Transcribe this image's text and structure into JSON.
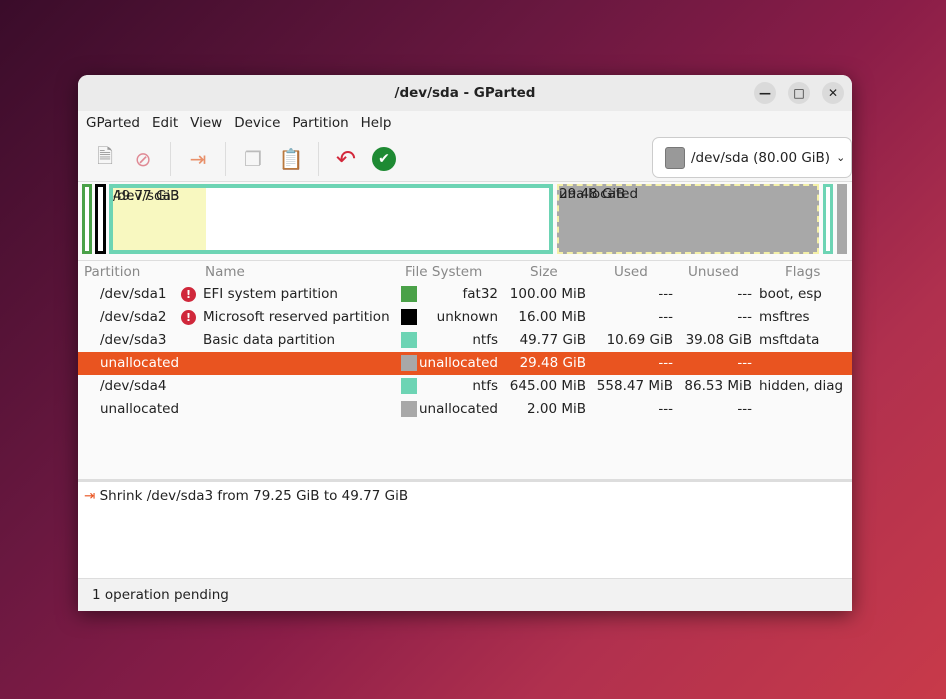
{
  "window": {
    "title": "/dev/sda - GParted"
  },
  "menu": [
    "GParted",
    "Edit",
    "View",
    "Device",
    "Partition",
    "Help"
  ],
  "device": {
    "label": "/dev/sda (80.00 GiB)"
  },
  "map": {
    "sda3": {
      "name": "/dev/sda3",
      "size": "49.77 GiB",
      "used_fraction": 0.21
    },
    "unalloc": {
      "name": "unallocated",
      "size": "29.48 GiB"
    }
  },
  "columns": [
    "Partition",
    "Name",
    "File System",
    "Size",
    "Used",
    "Unused",
    "Flags"
  ],
  "rows": [
    {
      "partition": "/dev/sda1",
      "name": "EFI system partition",
      "warn": true,
      "color": "#4aa148",
      "fs": "fat32",
      "size": "100.00 MiB",
      "used": "---",
      "unused": "---",
      "flags": "boot, esp"
    },
    {
      "partition": "/dev/sda2",
      "name": "Microsoft reserved partition",
      "warn": true,
      "color": "#000000",
      "fs": "unknown",
      "size": "16.00 MiB",
      "used": "---",
      "unused": "---",
      "flags": "msftres"
    },
    {
      "partition": "/dev/sda3",
      "name": "Basic data partition",
      "warn": false,
      "color": "#6dd4b4",
      "fs": "ntfs",
      "size": "49.77 GiB",
      "used": "10.69 GiB",
      "unused": "39.08 GiB",
      "flags": "msftdata"
    },
    {
      "partition": "unallocated",
      "name": "",
      "warn": false,
      "color": "#a8a8a8",
      "fs": "unallocated",
      "size": "29.48 GiB",
      "used": "---",
      "unused": "---",
      "flags": "",
      "selected": true
    },
    {
      "partition": "/dev/sda4",
      "name": "",
      "warn": false,
      "color": "#6dd4b4",
      "fs": "ntfs",
      "size": "645.00 MiB",
      "used": "558.47 MiB",
      "unused": "86.53 MiB",
      "flags": "hidden, diag"
    },
    {
      "partition": "unallocated",
      "name": "",
      "warn": false,
      "color": "#a8a8a8",
      "fs": "unallocated",
      "size": "2.00 MiB",
      "used": "---",
      "unused": "---",
      "flags": ""
    }
  ],
  "operations": [
    "Shrink /dev/sda3 from 79.25 GiB to 49.77 GiB"
  ],
  "status": "1 operation pending"
}
